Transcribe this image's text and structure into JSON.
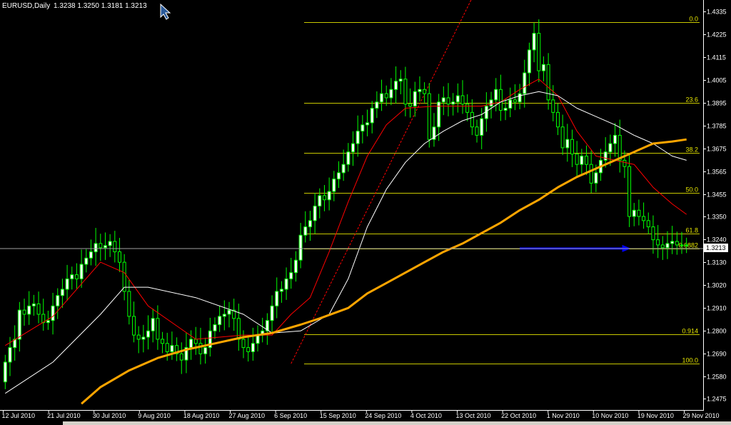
{
  "header": {
    "symbol": "EURUSD,Daily",
    "ohlc": "1.3238 1.3250 1.3181 1.3213"
  },
  "colors": {
    "background": "#000000",
    "bull_candle": "#ffffff",
    "bear_candle": "#000000",
    "candle_outline": "#00ff00",
    "fib_lines": "#c8c800",
    "ma_fast": "#ff0000",
    "ma_medium": "#ffffff",
    "ma_slow": "#ffa500",
    "trendline": "#ff0000",
    "arrow": "#0000ff",
    "crosshair": "#a0a0a0"
  },
  "chart_data": {
    "type": "candlestick",
    "title": "EURUSD,Daily",
    "ylim": [
      1.242,
      1.439
    ],
    "y_ticks": [
      "1.4335",
      "1.4225",
      "1.4115",
      "1.4005",
      "1.3895",
      "1.3785",
      "1.3675",
      "1.3565",
      "1.3455",
      "1.3350",
      "1.3240",
      "1.3130",
      "1.3020",
      "1.2910",
      "1.2800",
      "1.2690",
      "1.2580",
      "1.2475"
    ],
    "x_ticks": [
      "12 Jul 2010",
      "21 Jul 2010",
      "30 Jul 2010",
      "9 Aug 2010",
      "18 Aug 2010",
      "27 Aug 2010",
      "6 Sep 2010",
      "15 Sep 2010",
      "24 Sep 2010",
      "4 Oct 2010",
      "13 Oct 2010",
      "22 Oct 2010",
      "1 Nov 2010",
      "10 Nov 2010",
      "19 Nov 2010",
      "29 Nov 2010"
    ],
    "current_price": "1.3213",
    "fibonacci": {
      "high": 1.4283,
      "low": 1.2643,
      "levels": [
        {
          "label": "0.0",
          "price": 1.4283
        },
        {
          "label": "23.6",
          "price": 1.3896
        },
        {
          "label": "38.2",
          "price": 1.3656
        },
        {
          "label": "50.0",
          "price": 1.3463
        },
        {
          "label": "61.8",
          "price": 1.3269
        },
        {
          "label": "0.6882",
          "price": 1.3196
        },
        {
          "label": "0.914",
          "price": 1.2784
        },
        {
          "label": "100.0",
          "price": 1.2643
        }
      ]
    },
    "series": [
      {
        "name": "",
        "type": "candles",
        "x_index": [
          0,
          1,
          2,
          3,
          4,
          5,
          6,
          7,
          8,
          9,
          10,
          11,
          12,
          13,
          14,
          15,
          16,
          17,
          18,
          19,
          20,
          21,
          22,
          23,
          24,
          25,
          26,
          27,
          28,
          29,
          30,
          31,
          32,
          33,
          34,
          35,
          36,
          37,
          38,
          39,
          40,
          41,
          42,
          43,
          44,
          45,
          46,
          47,
          48,
          49,
          50,
          51,
          52,
          53,
          54,
          55,
          56,
          57,
          58,
          59,
          60,
          61,
          62,
          63,
          64,
          65,
          66,
          67,
          67,
          68,
          69,
          70,
          71,
          72,
          73,
          74,
          75,
          76,
          77,
          78,
          79,
          80,
          81,
          82,
          83,
          84,
          85,
          86,
          87,
          88,
          89,
          90,
          91,
          92,
          93,
          94,
          95,
          96,
          97,
          98,
          99,
          100,
          101,
          102,
          103,
          104,
          105,
          106,
          107,
          108,
          109,
          110,
          111,
          112,
          113,
          114,
          115,
          116,
          117,
          118,
          119,
          120,
          121,
          122,
          123,
          124,
          125,
          126,
          127,
          128,
          129,
          130,
          131,
          132,
          133,
          134,
          135,
          136,
          137,
          138,
          139,
          140,
          141,
          142,
          143
        ],
        "open": [
          1.2555,
          1.265,
          1.272,
          1.276,
          1.29,
          1.288,
          1.292,
          1.293,
          1.288,
          1.284,
          1.285,
          1.292,
          1.297,
          1.3,
          1.305,
          1.307,
          1.305,
          1.312,
          1.315,
          1.318,
          1.322,
          1.32,
          1.321,
          1.323,
          1.318,
          1.313,
          1.299,
          1.287,
          1.278,
          1.276,
          1.277,
          1.28,
          1.286,
          1.276,
          1.274,
          1.27,
          1.273,
          1.269,
          1.266,
          1.272,
          1.276,
          1.274,
          1.269,
          1.272,
          1.28,
          1.283,
          1.287,
          1.288,
          1.29,
          1.286,
          1.276,
          1.272,
          1.27,
          1.274,
          1.278,
          1.28,
          1.285,
          1.292,
          1.299,
          1.3,
          1.305,
          1.308,
          1.314,
          1.326,
          1.33,
          1.333,
          1.34,
          1.345,
          1.343,
          1.347,
          1.353,
          1.356,
          1.36,
          1.366,
          1.37,
          1.376,
          1.379,
          1.38,
          1.387,
          1.39,
          1.394,
          1.392,
          1.396,
          1.4,
          1.401,
          1.389,
          1.388,
          1.395,
          1.396,
          1.394,
          1.372,
          1.378,
          1.39,
          1.392,
          1.389,
          1.39,
          1.393,
          1.389,
          1.385,
          1.378,
          1.374,
          1.382,
          1.388,
          1.391,
          1.396,
          1.386,
          1.387,
          1.391,
          1.39,
          1.394,
          1.404,
          1.415,
          1.423,
          1.405,
          1.408,
          1.391,
          1.385,
          1.378,
          1.368,
          1.372,
          1.365,
          1.36,
          1.364,
          1.36,
          1.351,
          1.356,
          1.362,
          1.366,
          1.37,
          1.374,
          1.362,
          1.359,
          1.335,
          1.338,
          1.335,
          1.333,
          1.33,
          1.3238,
          1.3213,
          1.32,
          1.322,
          1.323,
          1.3213,
          1.3213
        ],
        "close": [
          1.265,
          1.272,
          1.276,
          1.29,
          1.288,
          1.292,
          1.293,
          1.288,
          1.284,
          1.285,
          1.292,
          1.297,
          1.3,
          1.305,
          1.307,
          1.305,
          1.312,
          1.315,
          1.318,
          1.322,
          1.32,
          1.321,
          1.323,
          1.318,
          1.313,
          1.299,
          1.287,
          1.278,
          1.276,
          1.277,
          1.28,
          1.286,
          1.276,
          1.274,
          1.27,
          1.273,
          1.269,
          1.266,
          1.272,
          1.276,
          1.274,
          1.269,
          1.272,
          1.28,
          1.283,
          1.287,
          1.288,
          1.29,
          1.286,
          1.276,
          1.272,
          1.27,
          1.274,
          1.278,
          1.28,
          1.285,
          1.292,
          1.299,
          1.3,
          1.305,
          1.308,
          1.314,
          1.326,
          1.33,
          1.333,
          1.34,
          1.345,
          1.343,
          1.347,
          1.353,
          1.356,
          1.36,
          1.366,
          1.37,
          1.376,
          1.379,
          1.38,
          1.387,
          1.39,
          1.394,
          1.392,
          1.396,
          1.4,
          1.401,
          1.389,
          1.388,
          1.395,
          1.396,
          1.394,
          1.372,
          1.378,
          1.39,
          1.392,
          1.389,
          1.39,
          1.393,
          1.389,
          1.385,
          1.378,
          1.374,
          1.382,
          1.388,
          1.391,
          1.396,
          1.386,
          1.387,
          1.391,
          1.39,
          1.394,
          1.404,
          1.415,
          1.423,
          1.405,
          1.408,
          1.391,
          1.385,
          1.378,
          1.368,
          1.372,
          1.365,
          1.36,
          1.364,
          1.36,
          1.351,
          1.356,
          1.362,
          1.366,
          1.37,
          1.374,
          1.362,
          1.359,
          1.335,
          1.338,
          1.335,
          1.333,
          1.33,
          1.3238,
          1.3213,
          1.32,
          1.322,
          1.323,
          1.3213,
          1.3213,
          1.3213
        ]
      },
      {
        "name": "",
        "type": "line",
        "role": "ma_fast",
        "points": [
          [
            0,
            1.273
          ],
          [
            10,
            1.287
          ],
          [
            20,
            1.313
          ],
          [
            25,
            1.308
          ],
          [
            30,
            1.292
          ],
          [
            40,
            1.276
          ],
          [
            50,
            1.278
          ],
          [
            56,
            1.278
          ],
          [
            60,
            1.288
          ],
          [
            64,
            1.296
          ],
          [
            68,
            1.318
          ],
          [
            72,
            1.342
          ],
          [
            76,
            1.364
          ],
          [
            80,
            1.379
          ],
          [
            84,
            1.387
          ],
          [
            90,
            1.388
          ],
          [
            96,
            1.388
          ],
          [
            100,
            1.388
          ],
          [
            104,
            1.39
          ],
          [
            108,
            1.396
          ],
          [
            112,
            1.401
          ],
          [
            116,
            1.393
          ],
          [
            120,
            1.376
          ],
          [
            124,
            1.364
          ],
          [
            128,
            1.362
          ],
          [
            132,
            1.36
          ],
          [
            136,
            1.349
          ],
          [
            140,
            1.341
          ],
          [
            143,
            1.336
          ]
        ]
      },
      {
        "name": "",
        "type": "line",
        "role": "ma_medium",
        "points": [
          [
            0,
            1.25
          ],
          [
            10,
            1.265
          ],
          [
            20,
            1.288
          ],
          [
            25,
            1.301
          ],
          [
            30,
            1.301
          ],
          [
            40,
            1.296
          ],
          [
            50,
            1.288
          ],
          [
            56,
            1.279
          ],
          [
            62,
            1.28
          ],
          [
            68,
            1.288
          ],
          [
            72,
            1.305
          ],
          [
            76,
            1.33
          ],
          [
            80,
            1.348
          ],
          [
            84,
            1.361
          ],
          [
            88,
            1.37
          ],
          [
            92,
            1.376
          ],
          [
            96,
            1.381
          ],
          [
            100,
            1.384
          ],
          [
            104,
            1.39
          ],
          [
            108,
            1.393
          ],
          [
            112,
            1.395
          ],
          [
            116,
            1.393
          ],
          [
            120,
            1.387
          ],
          [
            124,
            1.383
          ],
          [
            128,
            1.379
          ],
          [
            132,
            1.374
          ],
          [
            136,
            1.37
          ],
          [
            140,
            1.364
          ],
          [
            143,
            1.362
          ]
        ]
      },
      {
        "name": "",
        "type": "line",
        "role": "ma_slow",
        "points": [
          [
            16,
            1.245
          ],
          [
            20,
            1.253
          ],
          [
            26,
            1.261
          ],
          [
            32,
            1.267
          ],
          [
            38,
            1.271
          ],
          [
            44,
            1.274
          ],
          [
            50,
            1.277
          ],
          [
            56,
            1.279
          ],
          [
            62,
            1.283
          ],
          [
            66,
            1.286
          ],
          [
            72,
            1.291
          ],
          [
            76,
            1.298
          ],
          [
            80,
            1.303
          ],
          [
            84,
            1.308
          ],
          [
            88,
            1.313
          ],
          [
            92,
            1.318
          ],
          [
            96,
            1.322
          ],
          [
            100,
            1.327
          ],
          [
            104,
            1.332
          ],
          [
            108,
            1.338
          ],
          [
            112,
            1.343
          ],
          [
            116,
            1.349
          ],
          [
            120,
            1.354
          ],
          [
            124,
            1.358
          ],
          [
            128,
            1.362
          ],
          [
            132,
            1.366
          ],
          [
            136,
            1.37
          ],
          [
            140,
            1.371
          ],
          [
            143,
            1.372
          ]
        ]
      }
    ],
    "trendline": {
      "from": [
        60,
        1.2643
      ],
      "to": [
        98,
        1.44
      ]
    },
    "arrow": {
      "from_index": 108,
      "to_index": 131,
      "price": 1.3196
    }
  }
}
